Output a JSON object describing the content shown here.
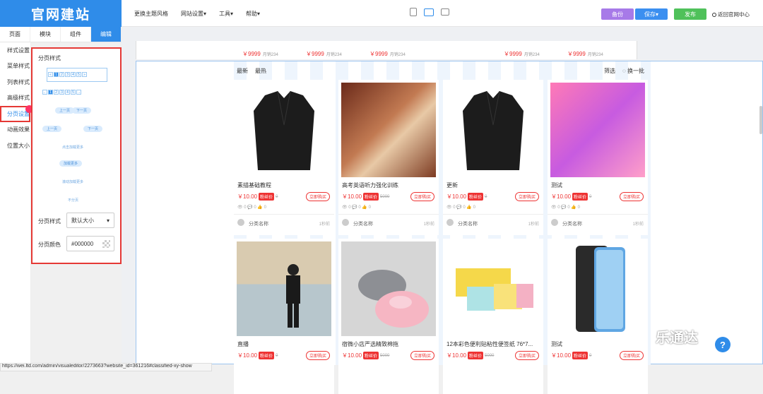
{
  "app": {
    "logo": "官网建站"
  },
  "menu": [
    "更换主题风格",
    "网站设置▾",
    "工具▾",
    "帮助▾"
  ],
  "actions": {
    "preview": "备份",
    "save": "保存▾",
    "publish": "发布",
    "back": "返回官网中心"
  },
  "tabs": [
    "页面",
    "模块",
    "组件",
    "编辑"
  ],
  "leftnav": [
    "样式设置",
    "菜单样式",
    "列表样式",
    "高级样式",
    "分页设置",
    "动画效果",
    "位置大小"
  ],
  "panel": {
    "title": "分页样式",
    "pager1": [
      "«",
      "1",
      "2",
      "3",
      "4",
      "5",
      "»"
    ],
    "pager2": [
      "←",
      "1",
      "2",
      "3",
      "4",
      "5",
      "→"
    ],
    "prev_next_a": [
      "上一页",
      "下一页"
    ],
    "prev_next_b": [
      "上一页",
      "下一页"
    ],
    "load_more_1": "点击加载更多",
    "load_more_2": "加载更多",
    "load_more_3": "滚动加载更多",
    "none": "不分页",
    "style_label": "分页样式",
    "style_value": "默认大小",
    "color_label": "分页颜色",
    "color_value": "#000000"
  },
  "strip_prices": [
    {
      "price": "￥9999",
      "sub": "月销234"
    },
    {
      "price": "￥9999",
      "sub": "月销234"
    },
    {
      "price": "￥9999",
      "sub": "月销234"
    },
    {
      "price": "￥9999",
      "sub": "月销234"
    },
    {
      "price": "￥9999",
      "sub": "月销234"
    }
  ],
  "sort": [
    "最新",
    "最热"
  ],
  "filter": [
    "筛选",
    "◌ 换一批"
  ],
  "products": [
    {
      "name": "素描基础教程",
      "price": "￥10.00",
      "tag": "粉丝价",
      "old": "0",
      "buy": "立即购买",
      "stats": "👁 0   💬 0   👍 0",
      "cat": "分类名称",
      "ago": "1秒前"
    },
    {
      "name": "高考英语听力强化训练",
      "price": "￥10.00",
      "tag": "粉丝价",
      "old": "5000",
      "buy": "立即购买",
      "stats": "👁 0   💬 0   👍 0",
      "cat": "分类名称",
      "ago": "1秒前"
    },
    {
      "name": "更新",
      "price": "￥10.00",
      "tag": "粉丝价",
      "old": "0",
      "buy": "立即购买",
      "stats": "👁 0   💬 0   👍 0",
      "cat": "分类名称",
      "ago": "1秒前"
    },
    {
      "name": "测试",
      "price": "￥10.00",
      "tag": "粉丝价",
      "old": "0",
      "buy": "立即购买",
      "stats": "👁 0   💬 0   👍 0",
      "cat": "分类名称",
      "ago": "1秒前"
    },
    {
      "name": "直播",
      "price": "￥10.00",
      "tag": "粉丝价",
      "old": "0",
      "buy": "立即购买",
      "stats": "",
      "cat": "",
      "ago": ""
    },
    {
      "name": "宿微小店严选精致棉拖",
      "price": "￥10.00",
      "tag": "粉丝价",
      "old": "5000",
      "buy": "立即购买",
      "stats": "",
      "cat": "",
      "ago": ""
    },
    {
      "name": "12本彩色便利贴粘性便签纸 76*7...",
      "price": "￥10.00",
      "tag": "粉丝价",
      "old": "5000",
      "buy": "立即购买",
      "stats": "",
      "cat": "",
      "ago": ""
    },
    {
      "name": "测试",
      "price": "￥10.00",
      "tag": "粉丝价",
      "old": "0",
      "buy": "立即购买",
      "stats": "",
      "cat": "",
      "ago": ""
    }
  ],
  "status_url": "https://wei.ltd.com/admin/visualeditor/2273663?website_id=361216#classified-xy-show",
  "watermark": "乐通达",
  "help": "?"
}
